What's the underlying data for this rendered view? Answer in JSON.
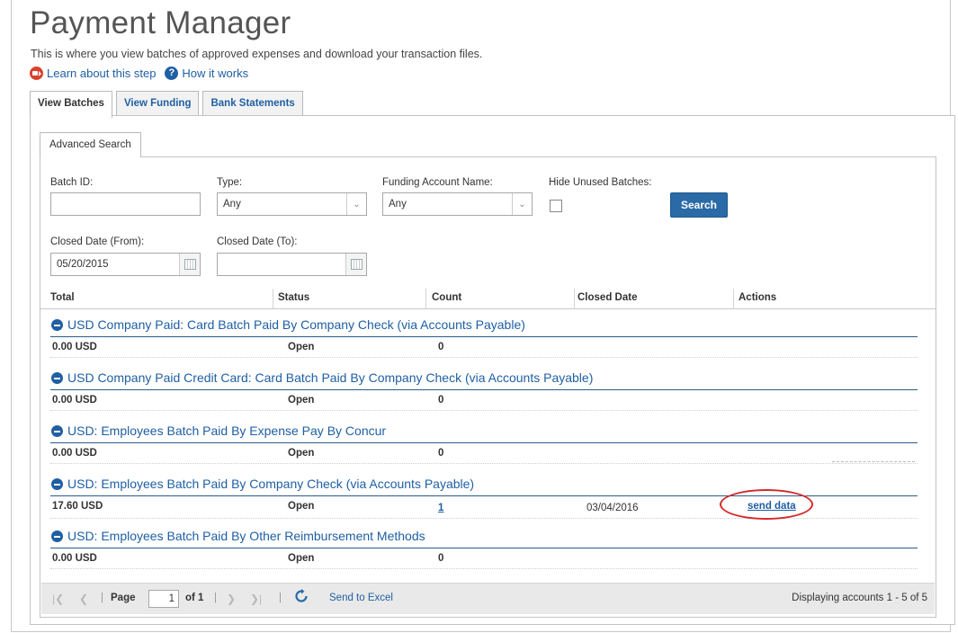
{
  "page": {
    "title": "Payment Manager",
    "subtitle": "This is where you view batches of approved expenses and download your transaction files.",
    "help_links": {
      "learn": "Learn about this step",
      "how": "How it works"
    }
  },
  "tabs": [
    "View Batches",
    "View Funding",
    "Bank Statements"
  ],
  "search_panel": {
    "tab_label": "Advanced Search",
    "batch_id": {
      "label": "Batch ID:",
      "value": ""
    },
    "type": {
      "label": "Type:",
      "selected": "Any"
    },
    "funding_account": {
      "label": "Funding Account Name:",
      "selected": "Any"
    },
    "hide_unused": {
      "label": "Hide Unused Batches:",
      "checked": false
    },
    "search_button": "Search",
    "closed_from": {
      "label": "Closed Date (From):",
      "value": "05/20/2015"
    },
    "closed_to": {
      "label": "Closed Date (To):",
      "value": ""
    }
  },
  "grid": {
    "columns": [
      "Total",
      "Status",
      "Count",
      "Closed Date",
      "Actions"
    ],
    "groups": [
      {
        "title": "USD Company Paid: Card Batch Paid By Company Check (via Accounts Payable)",
        "row": {
          "total": "0.00 USD",
          "status": "Open",
          "count": "0",
          "closed_date": "",
          "action": ""
        }
      },
      {
        "title": "USD Company Paid Credit Card: Card Batch Paid By Company Check (via Accounts Payable)",
        "row": {
          "total": "0.00 USD",
          "status": "Open",
          "count": "0",
          "closed_date": "",
          "action": ""
        }
      },
      {
        "title": "USD: Employees Batch Paid By Expense Pay By Concur",
        "row": {
          "total": "0.00 USD",
          "status": "Open",
          "count": "0",
          "closed_date": "",
          "action": ""
        }
      },
      {
        "title": "USD: Employees Batch Paid By Company Check (via Accounts Payable)",
        "row": {
          "total": "17.60 USD",
          "status": "Open",
          "count": "1",
          "closed_date": "03/04/2016",
          "action": "send data"
        }
      },
      {
        "title": "USD: Employees Batch Paid By Other Reimbursement Methods",
        "row": {
          "total": "0.00 USD",
          "status": "Open",
          "count": "0",
          "closed_date": "",
          "action": ""
        }
      }
    ]
  },
  "pager": {
    "page_label": "Page",
    "page_value": "1",
    "of_label": "of 1",
    "send_to_excel": "Send to Excel",
    "displaying": "Displaying accounts 1 - 5 of 5"
  },
  "colors": {
    "link": "#1f5fa3",
    "search_button": "#2a6aa6",
    "video_icon": "#d9412c",
    "highlight": "#d42a2a"
  }
}
